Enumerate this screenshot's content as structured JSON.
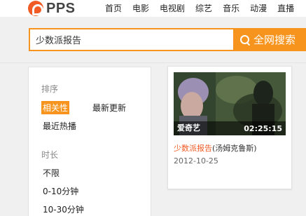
{
  "brand": {
    "name": "PPS",
    "color": "#f15a24"
  },
  "nav": [
    "首页",
    "电影",
    "电视剧",
    "综艺",
    "音乐",
    "动漫",
    "直播"
  ],
  "search": {
    "value": "少数派报告",
    "button_label": "全网搜索",
    "accent": "#f7941d"
  },
  "filters": {
    "sort": {
      "title": "排序",
      "options": [
        {
          "label": "相关性",
          "active": true
        },
        {
          "label": "最新更新",
          "active": false
        },
        {
          "label": "最近热播",
          "active": false
        }
      ]
    },
    "duration": {
      "title": "时长",
      "options": [
        "不限",
        "0-10分钟",
        "10-30分钟"
      ]
    }
  },
  "results": [
    {
      "source": "爱奇艺",
      "duration": "02:25:15",
      "title_highlight": "少数派报告",
      "title_rest": "(汤姆克鲁斯)",
      "date": "2012-10-25"
    }
  ]
}
